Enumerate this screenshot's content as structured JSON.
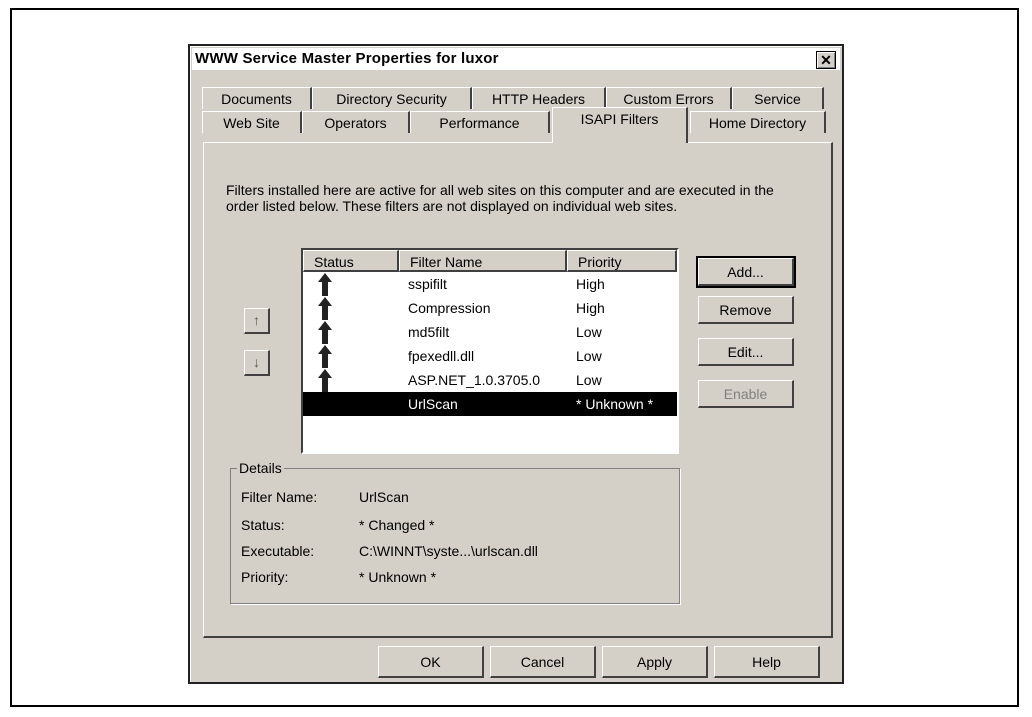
{
  "dialog": {
    "title": "WWW Service Master Properties for luxor",
    "close_glyph": "✕"
  },
  "tabs": {
    "row1": [
      "Documents",
      "Directory Security",
      "HTTP Headers",
      "Custom Errors",
      "Service"
    ],
    "row2": [
      "Web Site",
      "Operators",
      "Performance",
      "ISAPI Filters",
      "Home Directory"
    ],
    "active": "ISAPI Filters"
  },
  "description": "Filters installed here are active for all web sites on this computer and are executed in the order listed below.  These filters are not displayed on individual web sites.",
  "list": {
    "columns": [
      "Status",
      "Filter Name",
      "Priority"
    ],
    "rows": [
      {
        "name": "sspifilt",
        "priority": "High",
        "status_icon": "up-arrow-icon"
      },
      {
        "name": "Compression",
        "priority": "High",
        "status_icon": "up-arrow-icon"
      },
      {
        "name": "md5filt",
        "priority": "Low",
        "status_icon": "up-arrow-icon"
      },
      {
        "name": "fpexedll.dll",
        "priority": "Low",
        "status_icon": "up-arrow-icon"
      },
      {
        "name": "ASP.NET_1.0.3705.0",
        "priority": "Low",
        "status_icon": "up-arrow-icon"
      },
      {
        "name": "UrlScan",
        "priority": "* Unknown *",
        "status_icon": "",
        "selected": true
      }
    ]
  },
  "move_buttons": {
    "up": "↑",
    "down": "↓"
  },
  "side_buttons": {
    "add": "Add...",
    "remove": "Remove",
    "edit": "Edit...",
    "enable": "Enable"
  },
  "details": {
    "legend": "Details",
    "labels": [
      "Filter Name:",
      "Status:",
      "Executable:",
      "Priority:"
    ],
    "values": [
      "UrlScan",
      "* Changed *",
      "C:\\WINNT\\syste...\\urlscan.dll",
      "* Unknown *"
    ]
  },
  "footer": {
    "ok": "OK",
    "cancel": "Cancel",
    "apply": "Apply",
    "help": "Help"
  }
}
